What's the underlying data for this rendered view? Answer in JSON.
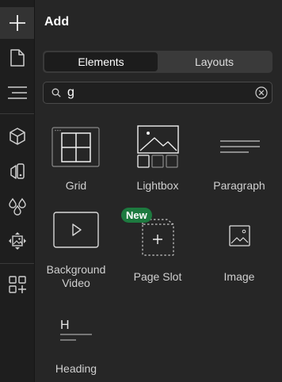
{
  "rail": {
    "items": [
      {
        "icon": "plus-icon",
        "active": true
      },
      {
        "icon": "page-icon",
        "active": false
      },
      {
        "icon": "layers-icon",
        "active": false
      },
      {
        "icon": "cube-icon",
        "active": false
      },
      {
        "icon": "paint-icon",
        "active": false
      },
      {
        "icon": "drops-icon",
        "active": false
      },
      {
        "icon": "media-icon",
        "active": false
      },
      {
        "icon": "apps-add-icon",
        "active": false
      }
    ]
  },
  "panel": {
    "title": "Add",
    "tabs": [
      {
        "label": "Elements",
        "active": true
      },
      {
        "label": "Layouts",
        "active": false
      }
    ],
    "search": {
      "value": "g",
      "placeholder": ""
    },
    "elements": [
      {
        "label": "Grid",
        "icon": "grid-icon"
      },
      {
        "label": "Lightbox",
        "icon": "lightbox-icon"
      },
      {
        "label": "Paragraph",
        "icon": "paragraph-icon"
      },
      {
        "label": "Background Video",
        "icon": "background-video-icon"
      },
      {
        "label": "Page Slot",
        "icon": "page-slot-icon",
        "badge": "New"
      },
      {
        "label": "Image",
        "icon": "image-icon"
      },
      {
        "label": "Heading",
        "icon": "heading-icon",
        "glyph": "H"
      }
    ]
  },
  "colors": {
    "rail_bg": "#1e1e1e",
    "panel_bg": "#262626",
    "badge_bg": "#1d7a3f"
  }
}
